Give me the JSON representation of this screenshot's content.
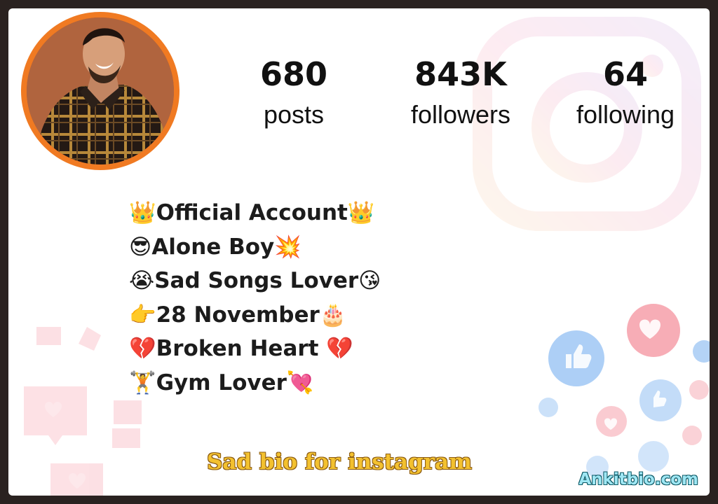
{
  "profile": {
    "stats": [
      {
        "value": "680",
        "label": "posts"
      },
      {
        "value": "843K",
        "label": "followers"
      },
      {
        "value": "64",
        "label": "following"
      }
    ],
    "bio": [
      "👑Official Account👑",
      "😎Alone Boy💥",
      "😭Sad Songs Lover😘",
      "👉28 November🎂",
      "💔Broken Heart 💔",
      "🏋Gym Lover💘"
    ]
  },
  "caption": "Sad bio for instagram",
  "site": "Ankitbio.com",
  "colors": {
    "ring": "#f07a22",
    "caption": "#f3c12f",
    "site": "#9fe7f4"
  }
}
